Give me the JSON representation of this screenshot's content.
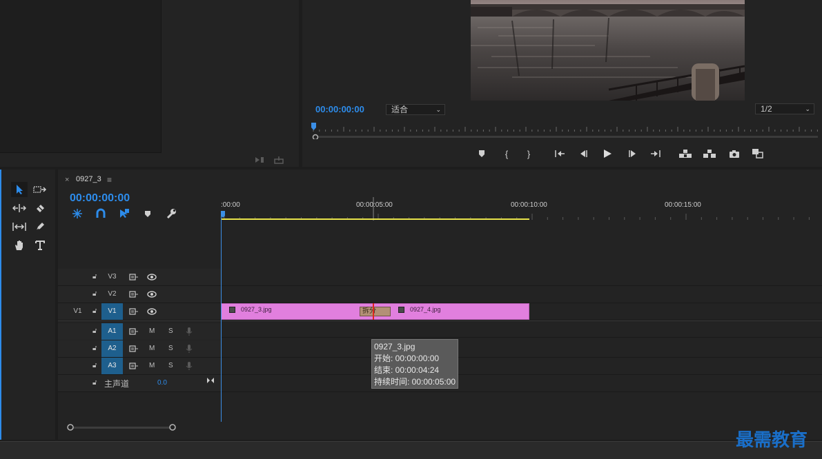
{
  "colors": {
    "accent": "#2d8ceb",
    "clip": "#e17fde",
    "workarea": "#e8e34a",
    "edit_point": "#e0271f",
    "track_active": "#1e5f8d"
  },
  "program_monitor": {
    "timecode": "00:00:00:00",
    "fit_label": "适合",
    "resolution_label": "1/2",
    "transport_icons": [
      "marker-icon",
      "mark-in-icon",
      "mark-out-icon",
      "go-to-in-icon",
      "step-back-icon",
      "play-icon",
      "step-forward-icon",
      "go-to-out-icon",
      "lift-icon",
      "extract-icon",
      "camera-icon",
      "compare-icon"
    ]
  },
  "sequence": {
    "tab_close": "×",
    "tab_name": "0927_3",
    "tab_menu": "≡",
    "timecode": "00:00:00:00",
    "ruler_labels": [
      ":00:00",
      "00:00:05:00",
      "00:00:10:00",
      "00:00:15:00"
    ]
  },
  "tracks": {
    "video": [
      {
        "name": "V3",
        "target": "",
        "active": false
      },
      {
        "name": "V2",
        "target": "",
        "active": false
      },
      {
        "name": "V1",
        "target": "V1",
        "active": true
      }
    ],
    "audio": [
      {
        "name": "A1",
        "m": "M",
        "s": "S"
      },
      {
        "name": "A2",
        "m": "M",
        "s": "S"
      },
      {
        "name": "A3",
        "m": "M",
        "s": "S"
      }
    ],
    "master": {
      "label": "主声道",
      "value": "0.0"
    }
  },
  "clips": {
    "a_label": "0927_3.jpg",
    "b_label": "0927_4.jpg",
    "transition_label": "拆分"
  },
  "tooltip": {
    "title": "0927_3.jpg",
    "start": "开始: 00:00:00:00",
    "end": "结束: 00:00:04:24",
    "duration": "持续时间: 00:00:05:00"
  },
  "watermark": "最需教育"
}
